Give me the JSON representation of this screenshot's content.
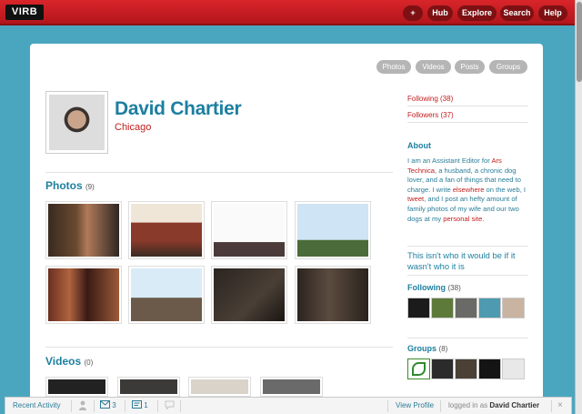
{
  "topbar": {
    "logo": "VIRB",
    "nav": [
      {
        "label": "+"
      },
      {
        "label": "Hub"
      },
      {
        "label": "Explore"
      },
      {
        "label": "Search"
      },
      {
        "label": "Help"
      }
    ]
  },
  "tabs": [
    {
      "label": "Photos"
    },
    {
      "label": "Videos"
    },
    {
      "label": "Posts"
    },
    {
      "label": "Groups"
    }
  ],
  "profile": {
    "name": "David Chartier",
    "location": "Chicago"
  },
  "photos": {
    "title": "Photos",
    "count": "(9)"
  },
  "videos": {
    "title": "Videos",
    "count": "(0)"
  },
  "sidebar": {
    "following_link": "Following (38)",
    "followers_link": "Followers (37)",
    "about_title": "About",
    "about": {
      "t1": "I am an Assistant Editor for ",
      "l1": "Ars Technica",
      "t2": ", a husband, a chronic dog lover, and a fan of things that need to charge. I write ",
      "l2": "elsewhere",
      "t3": " on the web, I ",
      "l3": "tweet",
      "t4": ", and I post an hefty amount of family photos of my wife and our two dogs at my ",
      "l4": "personal site",
      "t5": "."
    },
    "tagline": "This isn't who it would be if it wasn't who it is",
    "following_title": "Following",
    "following_count": "(38)",
    "groups_title": "Groups",
    "groups_count": "(8)"
  },
  "bottombar": {
    "recent_activity": "Recent Activity",
    "messages_count": "3",
    "notes_count": "1",
    "view_profile": "View Profile",
    "logged_in_prefix": "logged in as",
    "logged_in_user": "David Chartier",
    "close": "×"
  }
}
